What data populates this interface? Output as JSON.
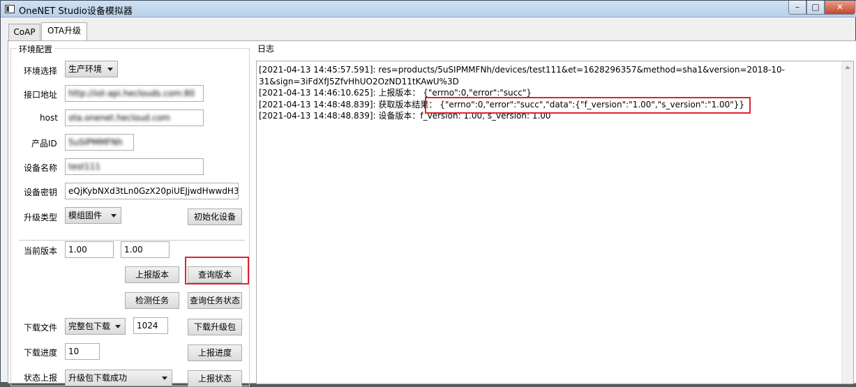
{
  "window": {
    "title": "OneNET Studio设备模拟器",
    "min": "–",
    "max": "□",
    "close": "✕"
  },
  "tabs": [
    {
      "label": "CoAP"
    },
    {
      "label": "OTA升级"
    }
  ],
  "env_group": {
    "legend": "环境配置",
    "env_select": {
      "label": "环境选择",
      "value": "生产环境"
    },
    "api_addr": {
      "label": "接口地址",
      "value": "http://iot-api.heclouds.com:80"
    },
    "host": {
      "label": "host",
      "value": "ota.onenet.hecloud.com"
    },
    "product_id": {
      "label": "产品ID",
      "value": "5uSIPMMFNh"
    },
    "device_name": {
      "label": "设备名称",
      "value": "test111"
    },
    "device_key": {
      "label": "设备密钥",
      "value": "eQjKybNXd3tLn0GzX20piUEJjwdHwwdH3"
    },
    "upgrade_type": {
      "label": "升级类型",
      "value": "模组固件"
    },
    "init_button": "初始化设备",
    "current_version": {
      "label": "当前版本",
      "f_version": "1.00",
      "s_version": "1.00"
    },
    "report_version_button": "上报版本",
    "query_version_button": "查询版本",
    "check_task_button": "检测任务",
    "query_task_status_button": "查询任务状态",
    "download_file": {
      "label": "下载文件",
      "value": "完整包下载",
      "size": "1024"
    },
    "download_button": "下载升级包",
    "download_progress": {
      "label": "下载进度",
      "value": "10"
    },
    "report_progress_button": "上报进度",
    "status_report": {
      "label": "状态上报",
      "value": "升级包下载成功"
    },
    "report_status_button": "上报状态"
  },
  "log_group": {
    "legend": "日志",
    "lines": [
      "[2021-04-13 14:45:57.591]: res=products/5uSIPMMFNh/devices/test111&et=1628296357&method=sha1&version=2018-10-",
      "31&sign=3iFdXfJ5ZfvHhUO2OzND11tKAwU%3D",
      "[2021-04-13 14:46:10.625]: 上报版本： {\"errno\":0,\"error\":\"succ\"}",
      "[2021-04-13 14:48:48.839]: 获取版本结果： {\"errno\":0,\"error\":\"succ\",\"data\":{\"f_version\":\"1.00\",\"s_version\":\"1.00\"}}",
      "[2021-04-13 14:48:48.839]: 设备版本：f_version: 1.00, s_version: 1.00"
    ]
  },
  "colors": {
    "highlight": "#e0232e",
    "titlebar": "#b9d1ea"
  }
}
